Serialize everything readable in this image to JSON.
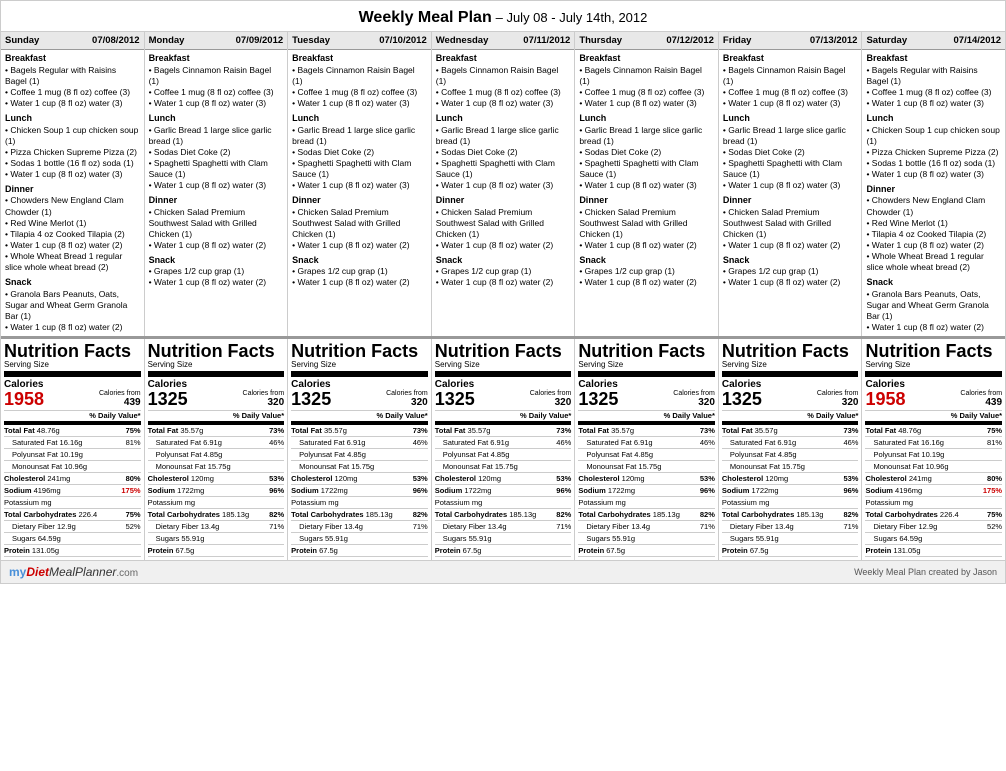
{
  "header": {
    "title": "Weekly Meal Plan",
    "subtitle": "– July 08 - July 14th, 2012"
  },
  "days": [
    {
      "name": "Sunday",
      "date": "07/08/2012",
      "breakfast": [
        "• Bagels Regular with Raisins Bagel (1)",
        "• Coffee 1 mug (8 fl oz) coffee (3)",
        "• Water 1 cup (8 fl oz) water (3)"
      ],
      "lunch": [
        "• Chicken Soup 1 cup chicken soup (1)",
        "• Pizza Chicken Supreme Pizza (2)",
        "• Sodas 1 bottle (16 fl oz) soda (1)",
        "• Water 1 cup (8 fl oz) water (3)"
      ],
      "dinner": [
        "• Chowders New England Clam Chowder (1)",
        "• Red Wine Merlot (1)",
        "• Tilapia 4 oz Cooked Tilapia (2)",
        "• Water 1 cup (8 fl oz) water (2)",
        "• Whole Wheat Bread 1 regular slice whole wheat bread (2)"
      ],
      "snack": [
        "• Granola Bars Peanuts, Oats, Sugar and Wheat Germ Granola Bar (1)",
        "• Water 1 cup (8 fl oz) water (2)"
      ],
      "nutrition": {
        "calories": "1958",
        "calories_from": "439",
        "cal_color": "red",
        "total_fat": "48.76g",
        "total_fat_pct": "75%",
        "sat_fat": "16.16g",
        "sat_fat_pct": "81%",
        "poly_fat": "10.19g",
        "mono_fat": "10.96g",
        "cholesterol": "241mg",
        "cholesterol_pct": "80%",
        "sodium": "4196mg",
        "sodium_pct": "175%",
        "sodium_color": "red",
        "potassium": "",
        "total_carbs": "226.4",
        "total_carbs_pct": "75%",
        "dietary_fiber": "12.9g",
        "dietary_fiber_pct": "52%",
        "sugars": "64.59g",
        "protein": "131.05g"
      }
    },
    {
      "name": "Monday",
      "date": "07/09/2012",
      "breakfast": [
        "• Bagels Cinnamon Raisin Bagel (1)",
        "• Coffee 1 mug (8 fl oz) coffee (3)",
        "• Water 1 cup (8 fl oz) water (3)"
      ],
      "lunch": [
        "• Garlic Bread 1 large slice garlic bread (1)",
        "• Sodas Diet Coke (2)",
        "• Spaghetti Spaghetti with Clam Sauce (1)",
        "• Water 1 cup (8 fl oz) water (3)"
      ],
      "dinner": [
        "• Chicken Salad Premium Southwest Salad with Grilled Chicken (1)",
        "• Water 1 cup (8 fl oz) water (2)"
      ],
      "snack": [
        "• Grapes 1/2 cup grap (1)",
        "• Water 1 cup (8 fl oz) water (2)"
      ],
      "nutrition": {
        "calories": "1325",
        "calories_from": "320",
        "cal_color": "black",
        "total_fat": "35.57g",
        "total_fat_pct": "73%",
        "sat_fat": "6.91g",
        "sat_fat_pct": "46%",
        "poly_fat": "4.85g",
        "mono_fat": "15.75g",
        "cholesterol": "120mg",
        "cholesterol_pct": "53%",
        "sodium": "1722mg",
        "sodium_pct": "96%",
        "sodium_color": "black",
        "potassium": "",
        "total_carbs": "185.13g",
        "total_carbs_pct": "82%",
        "dietary_fiber": "13.4g",
        "dietary_fiber_pct": "71%",
        "sugars": "55.91g",
        "protein": "67.5g"
      }
    },
    {
      "name": "Tuesday",
      "date": "07/10/2012",
      "breakfast": [
        "• Bagels Cinnamon Raisin Bagel (1)",
        "• Coffee 1 mug (8 fl oz) coffee (3)",
        "• Water 1 cup (8 fl oz) water (3)"
      ],
      "lunch": [
        "• Garlic Bread 1 large slice garlic bread (1)",
        "• Sodas Diet Coke (2)",
        "• Spaghetti Spaghetti with Clam Sauce (1)",
        "• Water 1 cup (8 fl oz) water (3)"
      ],
      "dinner": [
        "• Chicken Salad Premium Southwest Salad with Grilled Chicken (1)",
        "• Water 1 cup (8 fl oz) water (2)"
      ],
      "snack": [
        "• Grapes 1/2 cup grap (1)",
        "• Water 1 cup (8 fl oz) water (2)"
      ],
      "nutrition": {
        "calories": "1325",
        "calories_from": "320",
        "cal_color": "black",
        "total_fat": "35.57g",
        "total_fat_pct": "73%",
        "sat_fat": "6.91g",
        "sat_fat_pct": "46%",
        "poly_fat": "4.85g",
        "mono_fat": "15.75g",
        "cholesterol": "120mg",
        "cholesterol_pct": "53%",
        "sodium": "1722mg",
        "sodium_pct": "96%",
        "sodium_color": "black",
        "potassium": "",
        "total_carbs": "185.13g",
        "total_carbs_pct": "82%",
        "dietary_fiber": "13.4g",
        "dietary_fiber_pct": "71%",
        "sugars": "55.91g",
        "protein": "67.5g"
      }
    },
    {
      "name": "Wednesday",
      "date": "07/11/2012",
      "breakfast": [
        "• Bagels Cinnamon Raisin Bagel (1)",
        "• Coffee 1 mug (8 fl oz) coffee (3)",
        "• Water 1 cup (8 fl oz) water (3)"
      ],
      "lunch": [
        "• Garlic Bread 1 large slice garlic bread (1)",
        "• Sodas Diet Coke (2)",
        "• Spaghetti Spaghetti with Clam Sauce (1)",
        "• Water 1 cup (8 fl oz) water (3)"
      ],
      "dinner": [
        "• Chicken Salad Premium Southwest Salad with Grilled Chicken (1)",
        "• Water 1 cup (8 fl oz) water (2)"
      ],
      "snack": [
        "• Grapes 1/2 cup grap (1)",
        "• Water 1 cup (8 fl oz) water (2)"
      ],
      "nutrition": {
        "calories": "1325",
        "calories_from": "320",
        "cal_color": "black",
        "total_fat": "35.57g",
        "total_fat_pct": "73%",
        "sat_fat": "6.91g",
        "sat_fat_pct": "46%",
        "poly_fat": "4.85g",
        "mono_fat": "15.75g",
        "cholesterol": "120mg",
        "cholesterol_pct": "53%",
        "sodium": "1722mg",
        "sodium_pct": "96%",
        "sodium_color": "black",
        "potassium": "",
        "total_carbs": "185.13g",
        "total_carbs_pct": "82%",
        "dietary_fiber": "13.4g",
        "dietary_fiber_pct": "71%",
        "sugars": "55.91g",
        "protein": "67.5g"
      }
    },
    {
      "name": "Thursday",
      "date": "07/12/2012",
      "breakfast": [
        "• Bagels Cinnamon Raisin Bagel (1)",
        "• Coffee 1 mug (8 fl oz) coffee (3)",
        "• Water 1 cup (8 fl oz) water (3)"
      ],
      "lunch": [
        "• Garlic Bread 1 large slice garlic bread (1)",
        "• Sodas Diet Coke (2)",
        "• Spaghetti Spaghetti with Clam Sauce (1)",
        "• Water 1 cup (8 fl oz) water (3)"
      ],
      "dinner": [
        "• Chicken Salad Premium Southwest Salad with Grilled Chicken (1)",
        "• Water 1 cup (8 fl oz) water (2)"
      ],
      "snack": [
        "• Grapes 1/2 cup grap (1)",
        "• Water 1 cup (8 fl oz) water (2)"
      ],
      "nutrition": {
        "calories": "1325",
        "calories_from": "320",
        "cal_color": "black",
        "total_fat": "35.57g",
        "total_fat_pct": "73%",
        "sat_fat": "6.91g",
        "sat_fat_pct": "46%",
        "poly_fat": "4.85g",
        "mono_fat": "15.75g",
        "cholesterol": "120mg",
        "cholesterol_pct": "53%",
        "sodium": "1722mg",
        "sodium_pct": "96%",
        "sodium_color": "black",
        "potassium": "",
        "total_carbs": "185.13g",
        "total_carbs_pct": "82%",
        "dietary_fiber": "13.4g",
        "dietary_fiber_pct": "71%",
        "sugars": "55.91g",
        "protein": "67.5g"
      }
    },
    {
      "name": "Friday",
      "date": "07/13/2012",
      "breakfast": [
        "• Bagels Cinnamon Raisin Bagel (1)",
        "• Coffee 1 mug (8 fl oz) coffee (3)",
        "• Water 1 cup (8 fl oz) water (3)"
      ],
      "lunch": [
        "• Garlic Bread 1 large slice garlic bread (1)",
        "• Sodas Diet Coke (2)",
        "• Spaghetti Spaghetti with Clam Sauce (1)",
        "• Water 1 cup (8 fl oz) water (3)"
      ],
      "dinner": [
        "• Chicken Salad Premium Southwest Salad with Grilled Chicken (1)",
        "• Water 1 cup (8 fl oz) water (2)"
      ],
      "snack": [
        "• Grapes 1/2 cup grap (1)",
        "• Water 1 cup (8 fl oz) water (2)"
      ],
      "nutrition": {
        "calories": "1325",
        "calories_from": "320",
        "cal_color": "black",
        "total_fat": "35.57g",
        "total_fat_pct": "73%",
        "sat_fat": "6.91g",
        "sat_fat_pct": "46%",
        "poly_fat": "4.85g",
        "mono_fat": "15.75g",
        "cholesterol": "120mg",
        "cholesterol_pct": "53%",
        "sodium": "1722mg",
        "sodium_pct": "96%",
        "sodium_color": "black",
        "potassium": "",
        "total_carbs": "185.13g",
        "total_carbs_pct": "82%",
        "dietary_fiber": "13.4g",
        "dietary_fiber_pct": "71%",
        "sugars": "55.91g",
        "protein": "67.5g"
      }
    },
    {
      "name": "Saturday",
      "date": "07/14/2012",
      "breakfast": [
        "• Bagels Regular with Raisins Bagel (1)",
        "• Coffee 1 mug (8 fl oz) coffee (3)",
        "• Water 1 cup (8 fl oz) water (3)"
      ],
      "lunch": [
        "• Chicken Soup 1 cup chicken soup (1)",
        "• Pizza Chicken Supreme Pizza (2)",
        "• Sodas 1 bottle (16 fl oz) soda (1)",
        "• Water 1 cup (8 fl oz) water (3)"
      ],
      "dinner": [
        "• Chowders New England Clam Chowder (1)",
        "• Red Wine Merlot (1)",
        "• Tilapia 4 oz Cooked Tilapia (2)",
        "• Water 1 cup (8 fl oz) water (2)",
        "• Whole Wheat Bread 1 regular slice whole wheat bread (2)"
      ],
      "snack": [
        "• Granola Bars Peanuts, Oats, Sugar and Wheat Germ Granola Bar (1)",
        "• Water 1 cup (8 fl oz) water (2)"
      ],
      "nutrition": {
        "calories": "1958",
        "calories_from": "439",
        "cal_color": "red",
        "total_fat": "48.76g",
        "total_fat_pct": "75%",
        "sat_fat": "16.16g",
        "sat_fat_pct": "81%",
        "poly_fat": "10.19g",
        "mono_fat": "10.96g",
        "cholesterol": "241mg",
        "cholesterol_pct": "80%",
        "sodium": "4196mg",
        "sodium_pct": "175%",
        "sodium_color": "red",
        "potassium": "",
        "total_carbs": "226.4",
        "total_carbs_pct": "75%",
        "dietary_fiber": "12.9g",
        "dietary_fiber_pct": "52%",
        "sugars": "64.59g",
        "protein": "131.05g"
      }
    }
  ],
  "footer": {
    "logo": "myDietMealPlanner.com",
    "credit": "Weekly Meal Plan created by Jason"
  }
}
